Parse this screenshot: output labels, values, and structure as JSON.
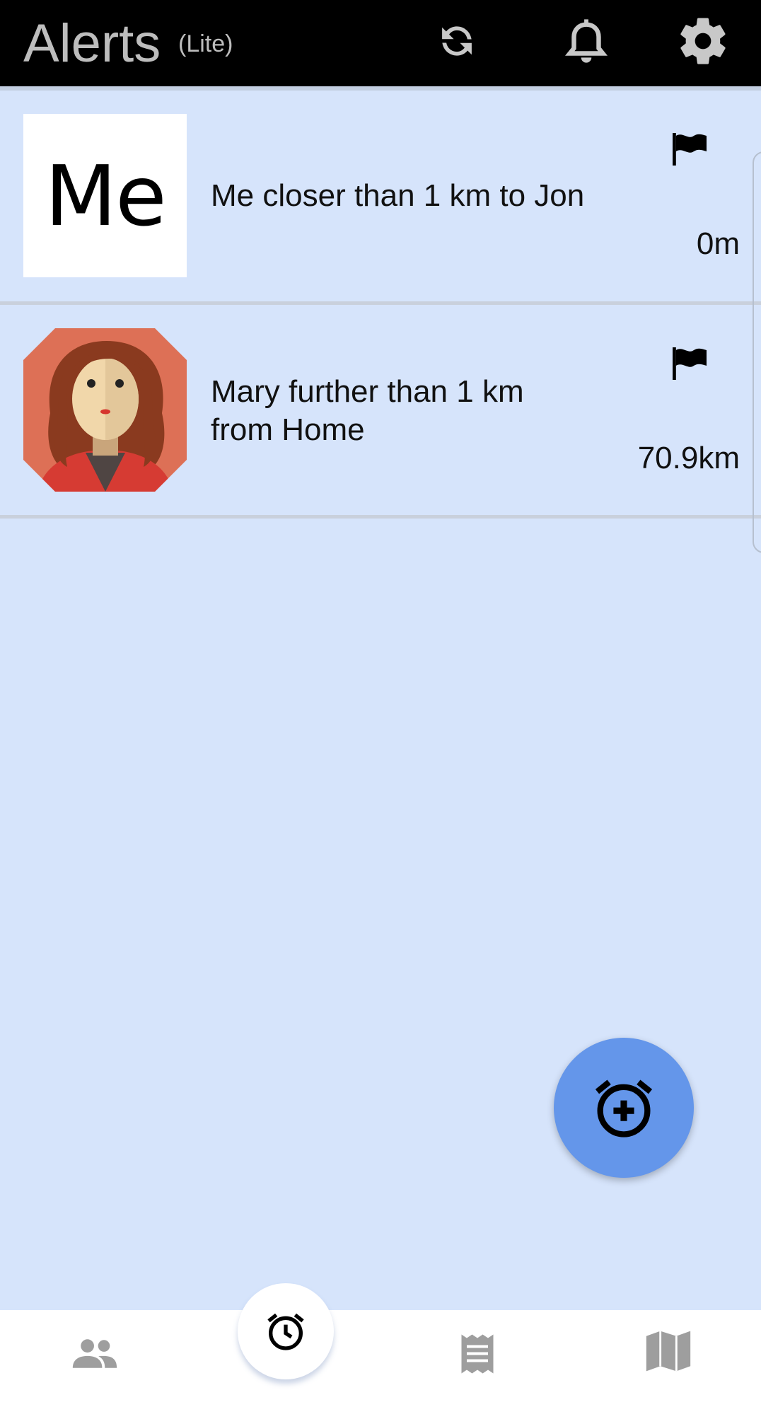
{
  "appbar": {
    "title": "Alerts",
    "subtitle": "(Lite)",
    "icons": [
      "refresh-icon",
      "bell-icon",
      "gear-icon"
    ]
  },
  "alerts": [
    {
      "avatar_text": "Me",
      "text": "Me closer than 1 km to Jon",
      "distance": "0m",
      "icon": "flag-icon"
    },
    {
      "avatar_text": "",
      "avatar_icon": "woman-avatar-icon",
      "text_line1": "Mary further than 1 km",
      "text_line2": "from Home",
      "distance": "70.9km",
      "icon": "flag-icon"
    }
  ],
  "fab": {
    "icon": "add-alarm-icon"
  },
  "bottom_nav": {
    "items": [
      "people-icon",
      "alarm-icon",
      "receipt-icon",
      "map-icon"
    ],
    "selected": "alarm-icon"
  },
  "colors": {
    "background": "#d6e4fb",
    "appbar": "#000000",
    "fab": "#6496ea",
    "nav_inactive": "#9e9e9e"
  }
}
